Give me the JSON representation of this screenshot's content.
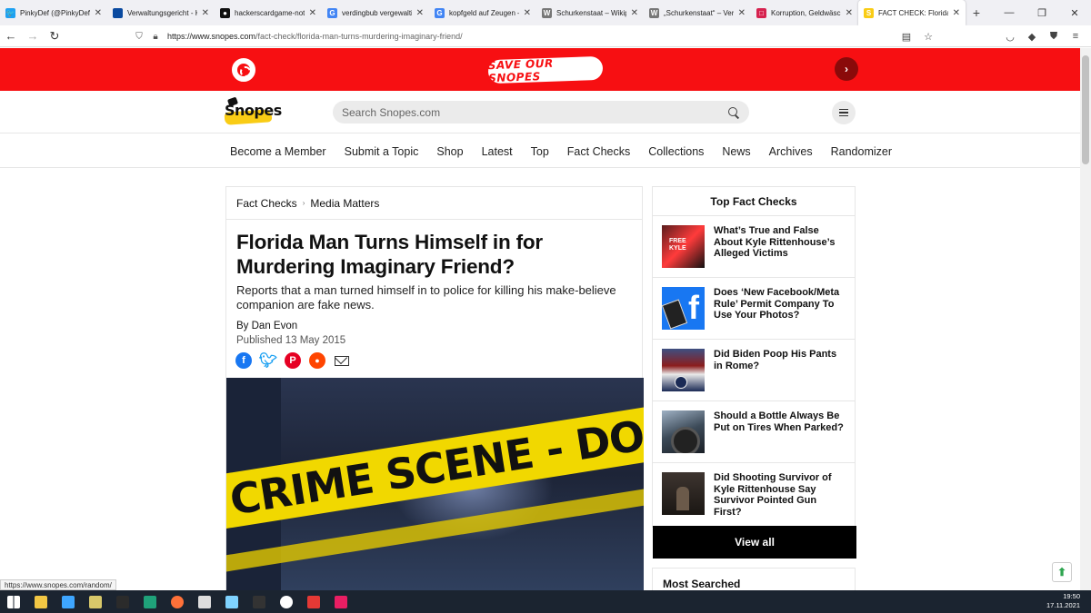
{
  "browser": {
    "tabs": [
      {
        "title": "PinkyDef (@PinkyDef) / T",
        "fav_color": "#1da1f2",
        "fav_glyph": "🐦"
      },
      {
        "title": "Verwaltungsgericht - Karl",
        "fav_color": "#0a4aa0",
        "fav_glyph": ""
      },
      {
        "title": "hackerscardgame-notes",
        "fav_color": "#111111",
        "fav_glyph": "●"
      },
      {
        "title": "verdingbub vergewaltigt",
        "fav_color": "#4285f4",
        "fav_glyph": "G"
      },
      {
        "title": "kopfgeld auf Zeugen – G",
        "fav_color": "#4285f4",
        "fav_glyph": "G"
      },
      {
        "title": "Schurkenstaat – Wikiped",
        "fav_color": "#777777",
        "fav_glyph": "W"
      },
      {
        "title": "„Schurkenstaat“ – Version",
        "fav_color": "#777777",
        "fav_glyph": "W"
      },
      {
        "title": "Korruption, Geldwäsche",
        "fav_color": "#d6224f",
        "fav_glyph": "□"
      },
      {
        "title": "FACT CHECK: Florida Ma",
        "fav_color": "#f9cc15",
        "fav_glyph": "S"
      }
    ],
    "new_tab": "+",
    "window_controls": [
      "—",
      "❐",
      "✕"
    ],
    "url_prefix": "https://www.snopes.com",
    "url_path": "/fact-check/florida-man-turns-murdering-imaginary-friend/",
    "status_link": "https://www.snopes.com/random/"
  },
  "banner": {
    "label": "SAVE OUR SNOPES",
    "arrow": "›",
    "color": "#f70f12"
  },
  "header": {
    "logo_text": "Snopes",
    "search_placeholder": "Search Snopes.com"
  },
  "nav": {
    "items": [
      "Become a Member",
      "Submit a Topic",
      "Shop",
      "Latest",
      "Top",
      "Fact Checks",
      "Collections",
      "News",
      "Archives",
      "Randomizer"
    ]
  },
  "article": {
    "breadcrumb": [
      "Fact Checks",
      "Media Matters"
    ],
    "title": "Florida Man Turns Himself in for Murdering Imaginary Friend?",
    "subtitle": "Reports that a man turned himself in to police for killing his make-believe companion are fake news.",
    "byline": "By Dan Evon",
    "published": "Published 13 May 2015",
    "share": [
      "facebook",
      "twitter",
      "pinterest",
      "reddit",
      "email"
    ],
    "hero_text": "CRIME SCENE - DO NOT ENTER"
  },
  "sidebar": {
    "title": "Top Fact Checks",
    "items": [
      {
        "text": "What’s True and False About Kyle Rittenhouse’s Alleged Victims"
      },
      {
        "text": "Does ‘New Facebook/Meta Rule’ Permit Company To Use Your Photos?"
      },
      {
        "text": "Did Biden Poop His Pants in Rome?"
      },
      {
        "text": "Should a Bottle Always Be Put on Tires When Parked?"
      },
      {
        "text": "Did Shooting Survivor of Kyle Rittenhouse Say Survivor Pointed Gun First?"
      }
    ],
    "view_all": "View all",
    "most_searched": "Most Searched"
  },
  "taskbar": {
    "time": "19:50",
    "date": "17.11.2021",
    "icons": [
      "windows-start",
      "file-explorer",
      "mail",
      "pen-app",
      "calculator-app",
      "edge",
      "firefox",
      "disk-app",
      "cloud-app",
      "live-app",
      "obs",
      "news-app",
      "red-app"
    ]
  }
}
